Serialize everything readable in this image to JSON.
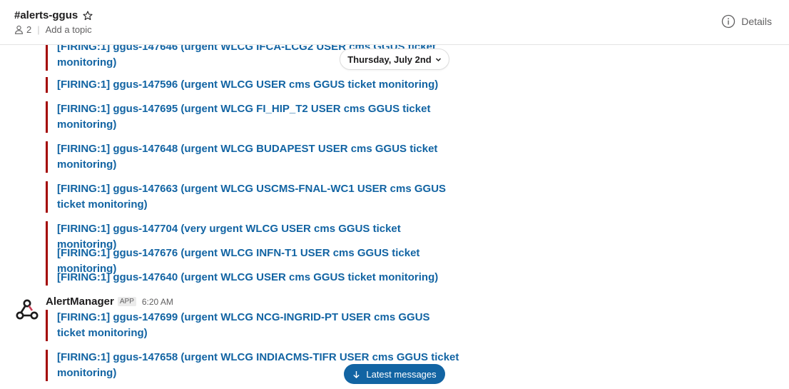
{
  "header": {
    "channel_name": "#alerts-ggus",
    "member_count": "2",
    "topic_placeholder": "Add a topic",
    "details_label": "Details"
  },
  "date_divider": {
    "label": "Thursday, July 2nd"
  },
  "messages_before": [
    {
      "text": "[FIRING:1] ggus-147646 (urgent WLCG IFCA-LCG2 USER cms GGUS ticket monitoring)"
    },
    {
      "text": "[FIRING:1] ggus-147596 (urgent WLCG USER cms GGUS ticket monitoring)"
    },
    {
      "text": "[FIRING:1] ggus-147695 (urgent WLCG FI_HIP_T2 USER cms GGUS ticket monitoring)"
    },
    {
      "text": "[FIRING:1] ggus-147648 (urgent WLCG BUDAPEST USER cms GGUS ticket monitoring)"
    },
    {
      "text": "[FIRING:1] ggus-147663 (urgent WLCG USCMS-FNAL-WC1 USER cms GGUS ticket monitoring)"
    },
    {
      "text": "[FIRING:1] ggus-147704 (very urgent WLCG USER cms GGUS ticket monitoring)"
    },
    {
      "text": "[FIRING:1] ggus-147676 (urgent WLCG INFN-T1 USER cms GGUS ticket monitoring)"
    },
    {
      "text": "[FIRING:1] ggus-147640 (urgent WLCG USER cms GGUS ticket monitoring)"
    }
  ],
  "sender": {
    "name": "AlertManager",
    "badge": "APP",
    "time": "6:20 AM",
    "avatar_icon": "webhook-icon"
  },
  "messages_after": [
    {
      "text": "[FIRING:1] ggus-147699 (urgent WLCG NCG-INGRID-PT USER cms GGUS ticket monitoring)"
    },
    {
      "text": "[FIRING:1] ggus-147658 (urgent WLCG INDIACMS-TIFR USER cms GGUS ticket monitoring)"
    }
  ],
  "latest_button": {
    "label": "Latest messages"
  },
  "colors": {
    "alert_bar": "#a30200",
    "link": "#1264a3",
    "button_bg": "#1264a3"
  }
}
